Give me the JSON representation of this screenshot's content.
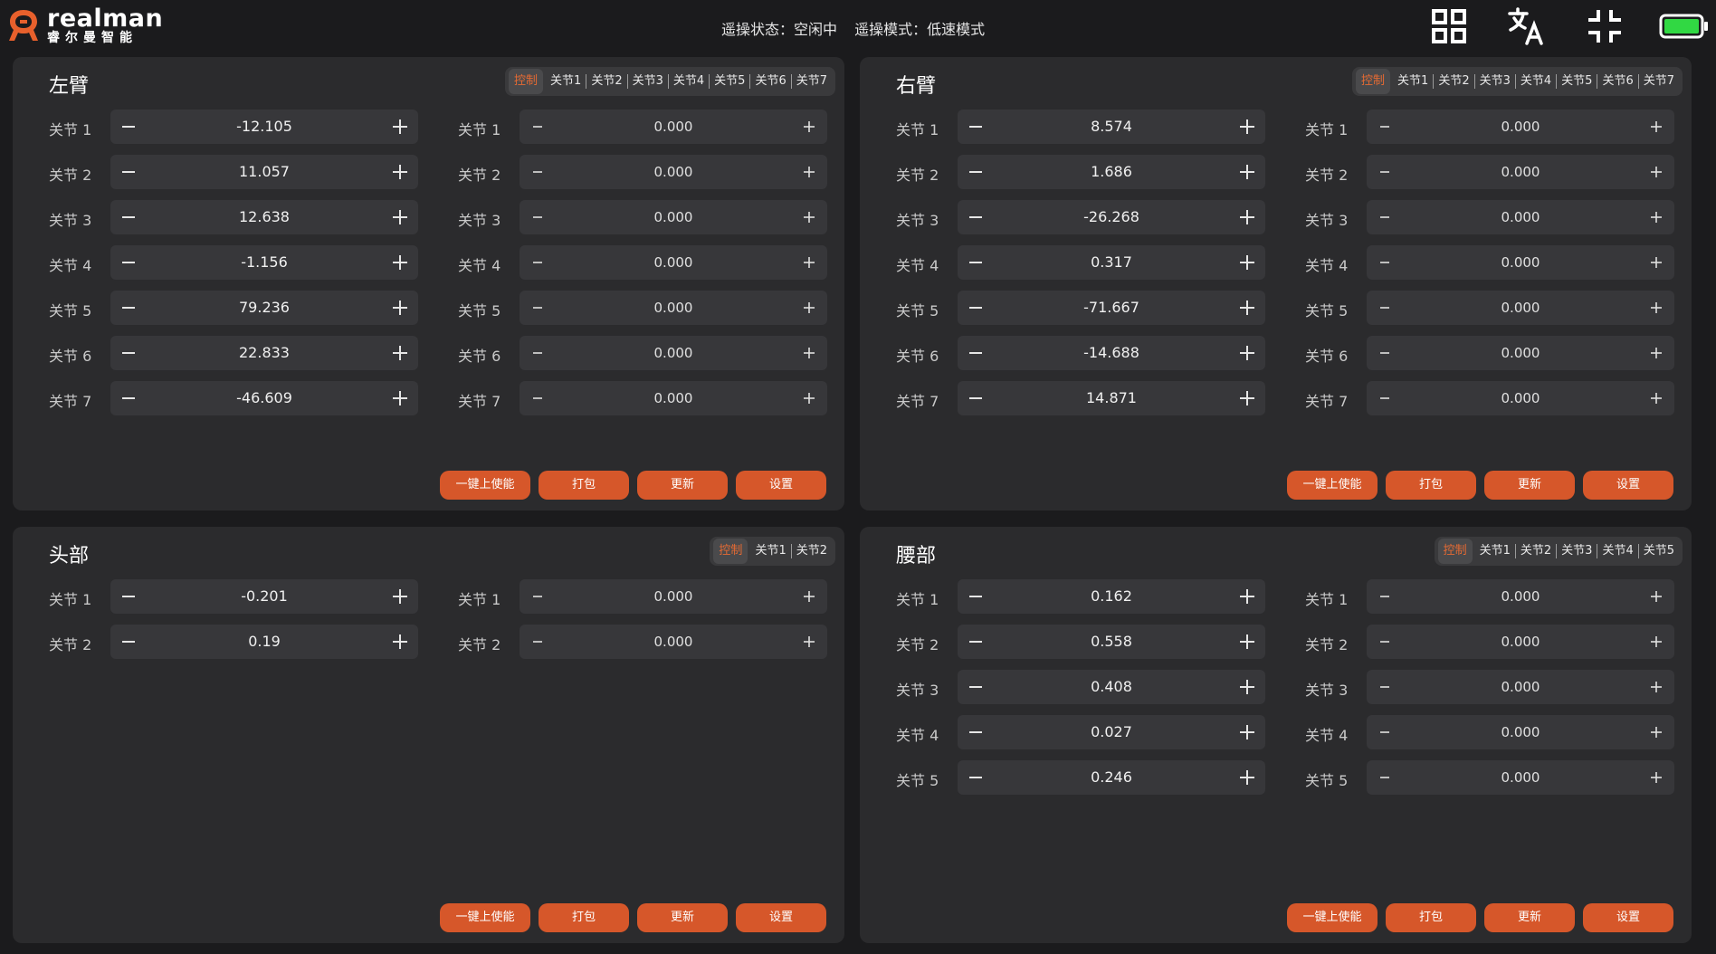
{
  "brand": {
    "word": "realman",
    "cn": "睿尔曼智能"
  },
  "status": {
    "state": "遥操状态：空闲中",
    "mode": "遥操模式：低速模式"
  },
  "colors": {
    "accent": "#d6572a",
    "active_tab": "#e46a33",
    "battery": "#31d843",
    "panel": "#2b2b2d",
    "background": "#1b1b1d"
  },
  "icons": {
    "grid": "grid-icon",
    "translate": "translate-icon",
    "collapse": "collapse-icon",
    "battery": "battery-icon"
  },
  "buttons": {
    "enable": "一键上使能",
    "pack": "打包",
    "update": "更新",
    "settings": "设置"
  },
  "panels": [
    {
      "title": "左臂",
      "tabs": [
        "控制",
        "关节1",
        "关节2",
        "关节3",
        "关节4",
        "关节5",
        "关节6",
        "关节7"
      ],
      "labels": [
        "关节 1",
        "关节 2",
        "关节 3",
        "关节 4",
        "关节 5",
        "关节 6",
        "关节 7"
      ],
      "left_values": [
        "-12.105",
        "11.057",
        "12.638",
        "-1.156",
        "79.236",
        "22.833",
        "-46.609"
      ],
      "right_values": [
        "0.000",
        "0.000",
        "0.000",
        "0.000",
        "0.000",
        "0.000",
        "0.000"
      ]
    },
    {
      "title": "右臂",
      "tabs": [
        "控制",
        "关节1",
        "关节2",
        "关节3",
        "关节4",
        "关节5",
        "关节6",
        "关节7"
      ],
      "labels": [
        "关节 1",
        "关节 2",
        "关节 3",
        "关节 4",
        "关节 5",
        "关节 6",
        "关节 7"
      ],
      "left_values": [
        "8.574",
        "1.686",
        "-26.268",
        "0.317",
        "-71.667",
        "-14.688",
        "14.871"
      ],
      "right_values": [
        "0.000",
        "0.000",
        "0.000",
        "0.000",
        "0.000",
        "0.000",
        "0.000"
      ]
    },
    {
      "title": "头部",
      "tabs": [
        "控制",
        "关节1",
        "关节2"
      ],
      "labels": [
        "关节 1",
        "关节 2"
      ],
      "left_values": [
        "-0.201",
        "0.19"
      ],
      "right_values": [
        "0.000",
        "0.000"
      ]
    },
    {
      "title": "腰部",
      "tabs": [
        "控制",
        "关节1",
        "关节2",
        "关节3",
        "关节4",
        "关节5"
      ],
      "labels": [
        "关节 1",
        "关节 2",
        "关节 3",
        "关节 4",
        "关节 5"
      ],
      "left_values": [
        "0.162",
        "0.558",
        "0.408",
        "0.027",
        "0.246"
      ],
      "right_values": [
        "0.000",
        "0.000",
        "0.000",
        "0.000",
        "0.000"
      ]
    }
  ]
}
